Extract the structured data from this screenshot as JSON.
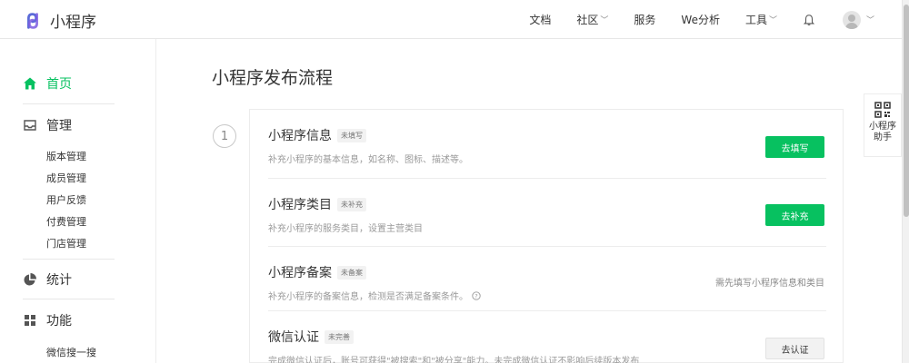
{
  "app": {
    "name": "小程序"
  },
  "nav": {
    "docs": "文档",
    "community": "社区",
    "services": "服务",
    "we_analysis": "We分析",
    "tools": "工具"
  },
  "sidebar": {
    "home": "首页",
    "management": "管理",
    "management_items": [
      "版本管理",
      "成员管理",
      "用户反馈",
      "付费管理",
      "门店管理"
    ],
    "statistics": "统计",
    "features": "功能",
    "features_items": [
      "微信搜一搜"
    ]
  },
  "main": {
    "title": "小程序发布流程",
    "step_number": "1",
    "rows": [
      {
        "title": "小程序信息",
        "tag": "未填写",
        "desc": "补充小程序的基本信息，如名称、图标、描述等。",
        "action": "去填写"
      },
      {
        "title": "小程序类目",
        "tag": "未补充",
        "desc": "补充小程序的服务类目，设置主营类目",
        "action": "去补充"
      },
      {
        "title": "小程序备案",
        "tag": "未备案",
        "desc": "补充小程序的备案信息，检测是否满足备案条件。",
        "hint": "需先填写小程序信息和类目"
      },
      {
        "title": "微信认证",
        "tag": "未完善",
        "desc": "完成微信认证后，账号可获得\"被搜索\"和\"被分享\"能力。未完成微信认证不影响后续版本发布",
        "action": "去认证"
      }
    ]
  },
  "assistant": {
    "label": "小程序助手"
  },
  "colors": {
    "accent": "#07c160",
    "text": "#353535",
    "muted": "#9a9a9a"
  }
}
